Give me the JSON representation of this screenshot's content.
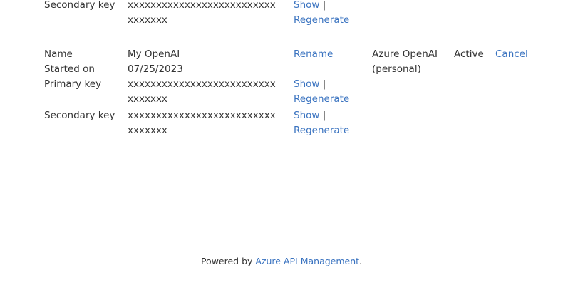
{
  "top_subscription": {
    "secondary_key": {
      "label": "Secondary key",
      "value": "xxxxxxxxxxxxxxxxxxxxxxxxxxxxxxxxx",
      "show_label": "Show",
      "separator": "|",
      "regenerate_label": "Regenerate"
    }
  },
  "subscription": {
    "name_label": "Name",
    "name_value": "My OpenAI",
    "rename_label": "Rename",
    "product": "Azure OpenAI (personal)",
    "state": "Active",
    "cancel_label": "Cancel",
    "started_label": "Started on",
    "started_value": "07/25/2023",
    "primary_key": {
      "label": "Primary key",
      "value": "xxxxxxxxxxxxxxxxxxxxxxxxxxxxxxxxx",
      "show_label": "Show",
      "separator": "|",
      "regenerate_label": "Regenerate"
    },
    "secondary_key": {
      "label": "Secondary key",
      "value": "xxxxxxxxxxxxxxxxxxxxxxxxxxxxxxxxx",
      "show_label": "Show",
      "separator": "|",
      "regenerate_label": "Regenerate"
    }
  },
  "footer": {
    "prefix": "Powered by ",
    "link_label": "Azure API Management",
    "suffix": "."
  }
}
